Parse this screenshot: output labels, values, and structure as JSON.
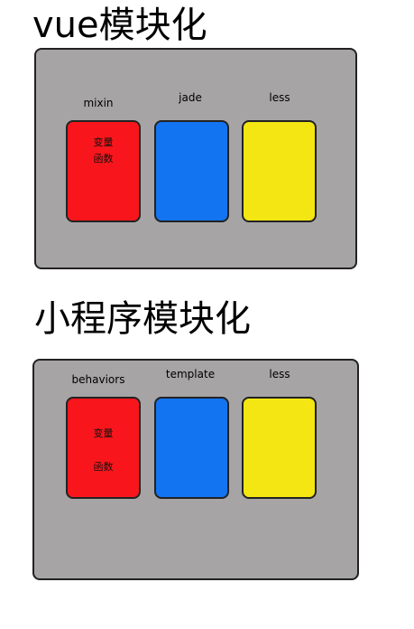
{
  "vue_section": {
    "title": "vue模块化",
    "labels": [
      "mixin",
      "jade",
      "less"
    ],
    "red_card_lines": [
      "变量",
      "函数"
    ]
  },
  "mp_section": {
    "title": "小程序模块化",
    "labels": [
      "behaviors",
      "template",
      "less"
    ],
    "red_card_lines": [
      "变量",
      "函数"
    ]
  },
  "colors": {
    "panel": "#a6a4a4",
    "red": "#f8161c",
    "blue": "#1374f1",
    "yellow": "#f4e612"
  }
}
